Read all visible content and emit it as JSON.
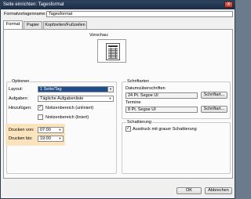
{
  "window": {
    "title": "Seite einrichten: Tagesformat",
    "close_label": "X"
  },
  "style_name": {
    "label": "Formatvorlagenname:",
    "value": "Tagesformat"
  },
  "tabs": [
    {
      "label": "Format"
    },
    {
      "label": "Papier"
    },
    {
      "label": "Kopfzeilen/Fußzeilen"
    }
  ],
  "preview": {
    "label": "Vorschau:"
  },
  "options": {
    "title": "Optionen",
    "layout_label": "Layout:",
    "layout_value": "1 Seite/Tag",
    "tasks_label": "Aufgaben:",
    "tasks_value": "Tägliche Aufgabenliste",
    "include_label": "Hinzufügen:",
    "notes_lined": "Notizenbereich (unliniert)",
    "notes_ruled": "Notizenbereich (liniert)",
    "print_from_label": "Drucken von:",
    "print_from_value": "07:00",
    "print_to_label": "Drucken bis:",
    "print_to_value": "19:00"
  },
  "fonts": {
    "title": "Schriftarten",
    "date_headings_label": "Datumsüberschriften",
    "date_headings_value": "24 Pt. Segoe UI",
    "appointments_label": "Termine",
    "appointments_value": "8 Pt. Segoe UI",
    "font_button": "Schriftart..."
  },
  "shading": {
    "title": "Schattierung",
    "gray_shading": "Ausdruck mit grauer Schattierung"
  },
  "footer": {
    "ok": "OK",
    "cancel": "Abbrechen"
  }
}
